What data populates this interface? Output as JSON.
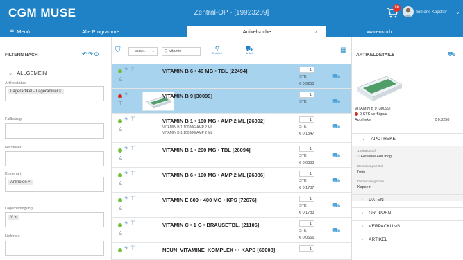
{
  "app": {
    "logo": "CGM MUSE",
    "window_title": "Zentral-OP - [19923209]",
    "notification_count": "10",
    "user_name": "Simone Kapeller"
  },
  "tabs": {
    "menu": "Menü",
    "all_programs": "Alle Programme",
    "article_search": "Artikelsuche",
    "close": "×",
    "cart": "Warenkorb"
  },
  "filter": {
    "title": "FILTERN NACH",
    "group": "ALLGEMEIN",
    "fields": [
      {
        "label": "Artikelstatus",
        "chip": "Lagerartikel - Lagerartikel  ×"
      },
      {
        "label": "Fallbezug",
        "chip": ""
      },
      {
        "label": "Hersteller",
        "chip": ""
      },
      {
        "label": "Kostenart",
        "chip": "Arzneien  ×"
      },
      {
        "label": "Lagerbedingung",
        "chip": "V  ×"
      },
      {
        "label": "Lieferant",
        "chip": ""
      }
    ]
  },
  "toolbar": {
    "select_value": "Hausk...",
    "search_value": "vitamin",
    "erweitert_label": "Erweitert",
    "artikel_label": "Artikel",
    "more": "..."
  },
  "articles": [
    {
      "name": "VITAMIN B 6 • 40 MG • TBL [22494]",
      "status": "green",
      "qty": "1",
      "unit": "STK",
      "price": "€ 0.0250",
      "sub1": "",
      "sub2": "",
      "selected": true
    },
    {
      "name": "VITAMIN B 9 [30099]",
      "status": "red",
      "qty": "1",
      "unit": "STK",
      "price": "",
      "sub1": "",
      "sub2": "",
      "selected": true
    },
    {
      "name": "VITAMIN B 1 • 100 MG • AMP 2 ML [26092]",
      "status": "green",
      "qty": "1",
      "unit": "STK",
      "price": "€ 0.1547",
      "sub1": "VITAMIN B 1 100 MG AMP 2 ML",
      "sub2": "VITAMIN B 1 100 MG AMP 2 ML",
      "selected": false
    },
    {
      "name": "VITAMIN B 1 • 200 MG • TBL [26094]",
      "status": "green",
      "qty": "1",
      "unit": "STK",
      "price": "€ 0.0333",
      "sub1": "",
      "sub2": "",
      "selected": false
    },
    {
      "name": "VITAMIN B 6 • 100 MG • AMP 2 ML [26086]",
      "status": "green",
      "qty": "1",
      "unit": "STK",
      "price": "€ 0.1737",
      "sub1": "",
      "sub2": "",
      "selected": false
    },
    {
      "name": "VITAMIN E 600 • 400 MG • KPS [72676]",
      "status": "green",
      "qty": "1",
      "unit": "STK",
      "price": "€ 0.1783",
      "sub1": "",
      "sub2": "",
      "selected": false
    },
    {
      "name": "VITAMIN C • 1 G • BRAUSETBL. [21106]",
      "status": "green",
      "qty": "1",
      "unit": "STK",
      "price": "€ 0.0666",
      "sub1": "",
      "sub2": "",
      "selected": false
    },
    {
      "name": "NEUN_VITAMINE_KOMPLEX • • KAPS [66008]",
      "status": "green",
      "qty": "1",
      "unit": "",
      "price": "",
      "sub1": "",
      "sub2": "",
      "selected": false
    }
  ],
  "details": {
    "title": "ARTIKELDETAILS",
    "article": "VITAMIN B 9 [30099]",
    "stock": "0 STK verfügbar",
    "location": "Apotheke",
    "price": "€ 0.0250",
    "open_section": "APOTHEKE",
    "fields": [
      {
        "label": "1 Inhaltsstoff",
        "value": "◌ Folsäure 400 mcg"
      },
      {
        "label": "Betäubungsmittel",
        "value": "Nein"
      },
      {
        "label": "Darreichungsform",
        "value": "Kapseln"
      }
    ],
    "sections": [
      "DATEN",
      "GRUPPEN",
      "VERPACKUNG",
      "ARTIKEL"
    ]
  }
}
